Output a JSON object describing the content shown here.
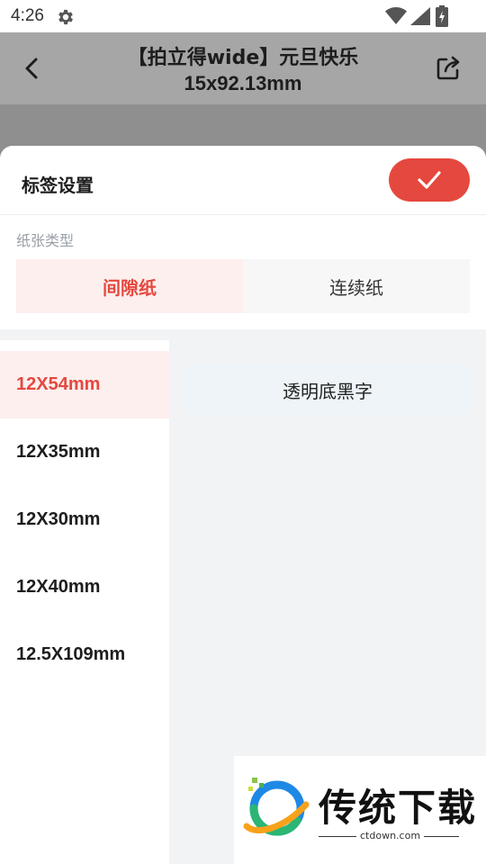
{
  "status": {
    "time": "4:26"
  },
  "appbar": {
    "title": "【拍立得wide】元旦快乐",
    "subtitle": "15x92.13mm"
  },
  "sheet": {
    "title": "标签设置",
    "section_label": "纸张类型",
    "paper_types": [
      {
        "label": "间隙纸",
        "selected": true
      },
      {
        "label": "连续纸",
        "selected": false
      }
    ],
    "sizes": [
      {
        "label": "12X54mm",
        "selected": true
      },
      {
        "label": "12X35mm",
        "selected": false
      },
      {
        "label": "12X30mm",
        "selected": false
      },
      {
        "label": "12X40mm",
        "selected": false
      },
      {
        "label": "12.5X109mm",
        "selected": false
      }
    ],
    "label_types": [
      {
        "label": "透明底黑字"
      }
    ]
  },
  "watermark": {
    "title": "传统下载",
    "url": "ctdown.com"
  },
  "colors": {
    "accent": "#e5483e",
    "accent_light": "#fcefee",
    "appbar": "#a6a6a6"
  },
  "icons": [
    "gear-icon",
    "wifi-icon",
    "signal-icon",
    "battery-icon",
    "back-icon",
    "share-icon",
    "check-icon"
  ]
}
